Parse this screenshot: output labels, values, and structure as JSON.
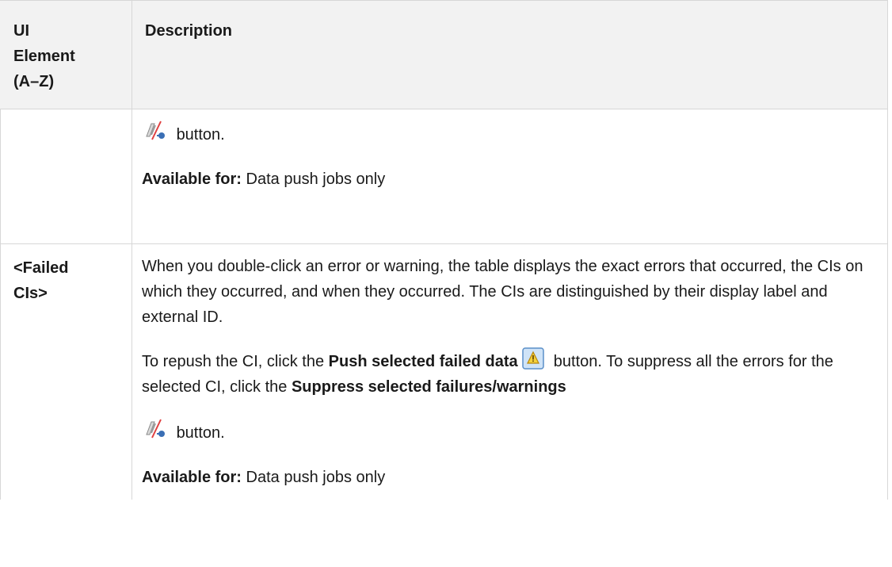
{
  "table": {
    "headers": {
      "element": "UI Element (A–Z)",
      "element_lines": [
        "UI",
        "Element",
        "(A–Z)"
      ],
      "description": "Description"
    },
    "rows": [
      {
        "element": "",
        "button_word": "button.",
        "available_label": "Available for:",
        "available_value": "Data push jobs only"
      },
      {
        "element_lines": [
          "<Failed",
          "CIs>"
        ],
        "intro": "When you double-click an error or warning, the table displays the exact errors that occurred, the CIs on which they occurred, and when they occurred. The CIs are distinguished by their display label and external ID.",
        "repush_before": "To repush the CI, click the ",
        "repush_bold": "Push selected failed data",
        "repush_after": " button. To suppress all the errors for the selected CI, click the ",
        "suppress_bold": "Suppress selected failures/warnings",
        "button_word": "button.",
        "available_label": "Available for:",
        "available_value": "Data push jobs only"
      }
    ]
  },
  "icons": {
    "suppress": "suppress-failures-icon",
    "push": "push-failed-data-icon"
  }
}
